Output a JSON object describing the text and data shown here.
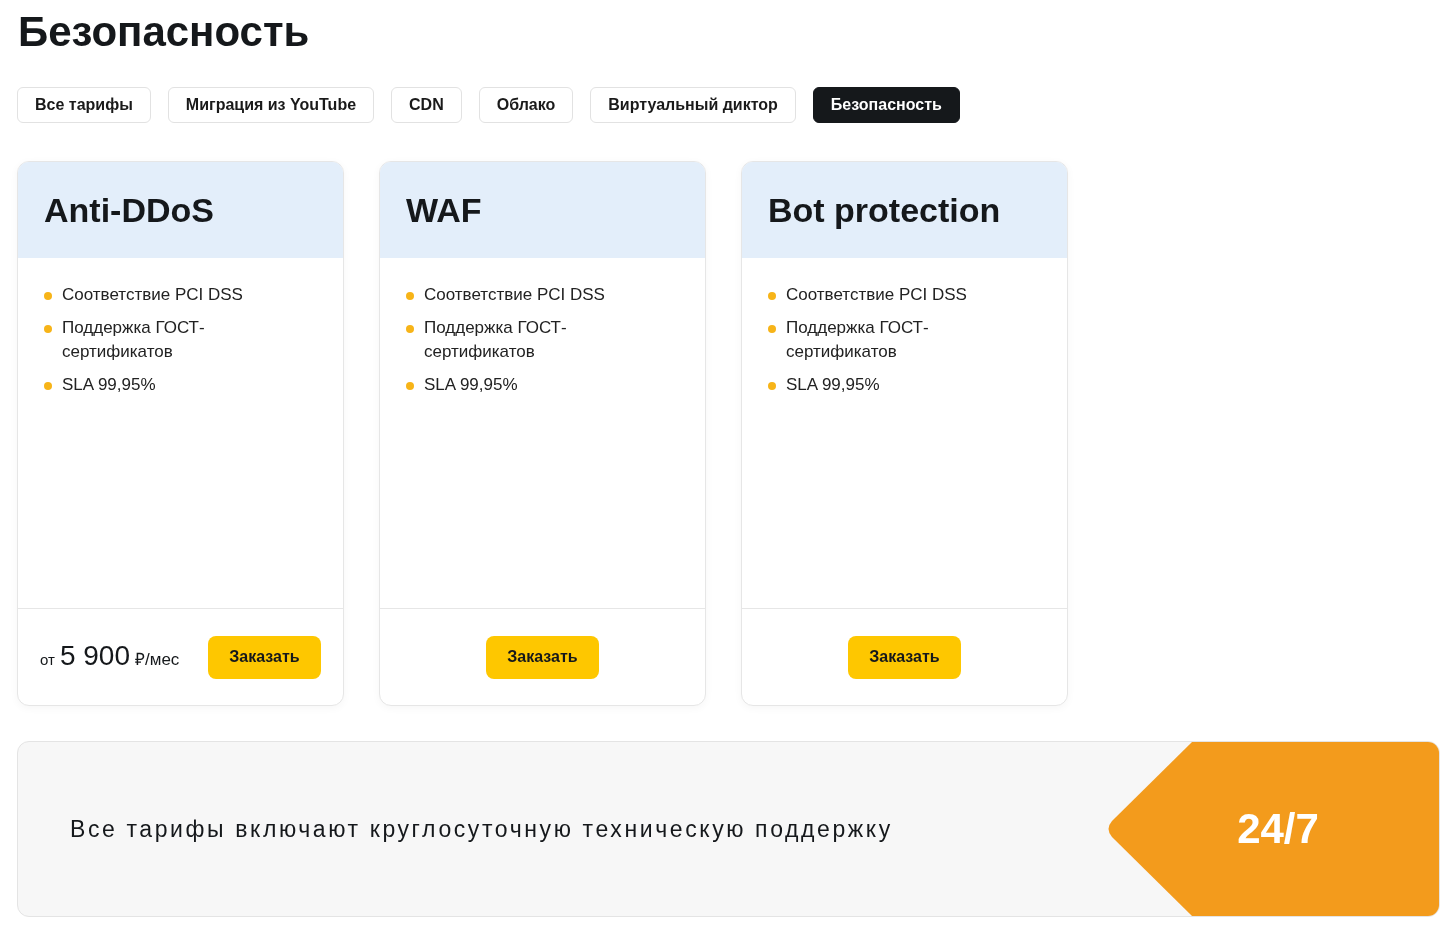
{
  "page_title": "Безопасность",
  "tabs": [
    {
      "label": "Все тарифы",
      "selected": false
    },
    {
      "label": "Миграция из YouTube",
      "selected": false
    },
    {
      "label": "CDN",
      "selected": false
    },
    {
      "label": "Облако",
      "selected": false
    },
    {
      "label": "Виртуальный диктор",
      "selected": false
    },
    {
      "label": "Безопасность",
      "selected": true
    }
  ],
  "plans": [
    {
      "name": "Anti-DDoS",
      "features": [
        "Соответствие PCI DSS",
        "Поддержка ГОСТ-сертификатов",
        "SLA 99,95%"
      ],
      "price": {
        "prefix": "от",
        "amount": "5 900",
        "unit": "₽/мес"
      },
      "order_button": "Заказать"
    },
    {
      "name": "WAF",
      "features": [
        "Соответствие PCI DSS",
        "Поддержка ГОСТ-сертификатов",
        "SLA 99,95%"
      ],
      "order_button": "Заказать"
    },
    {
      "name": "Bot protection",
      "features": [
        "Соответствие PCI DSS",
        "Поддержка ГОСТ-сертификатов",
        "SLA 99,95%"
      ],
      "order_button": "Заказать"
    }
  ],
  "banner": {
    "text": "Все тарифы включают круглосуточную техническую поддержку",
    "badge": "24/7"
  }
}
